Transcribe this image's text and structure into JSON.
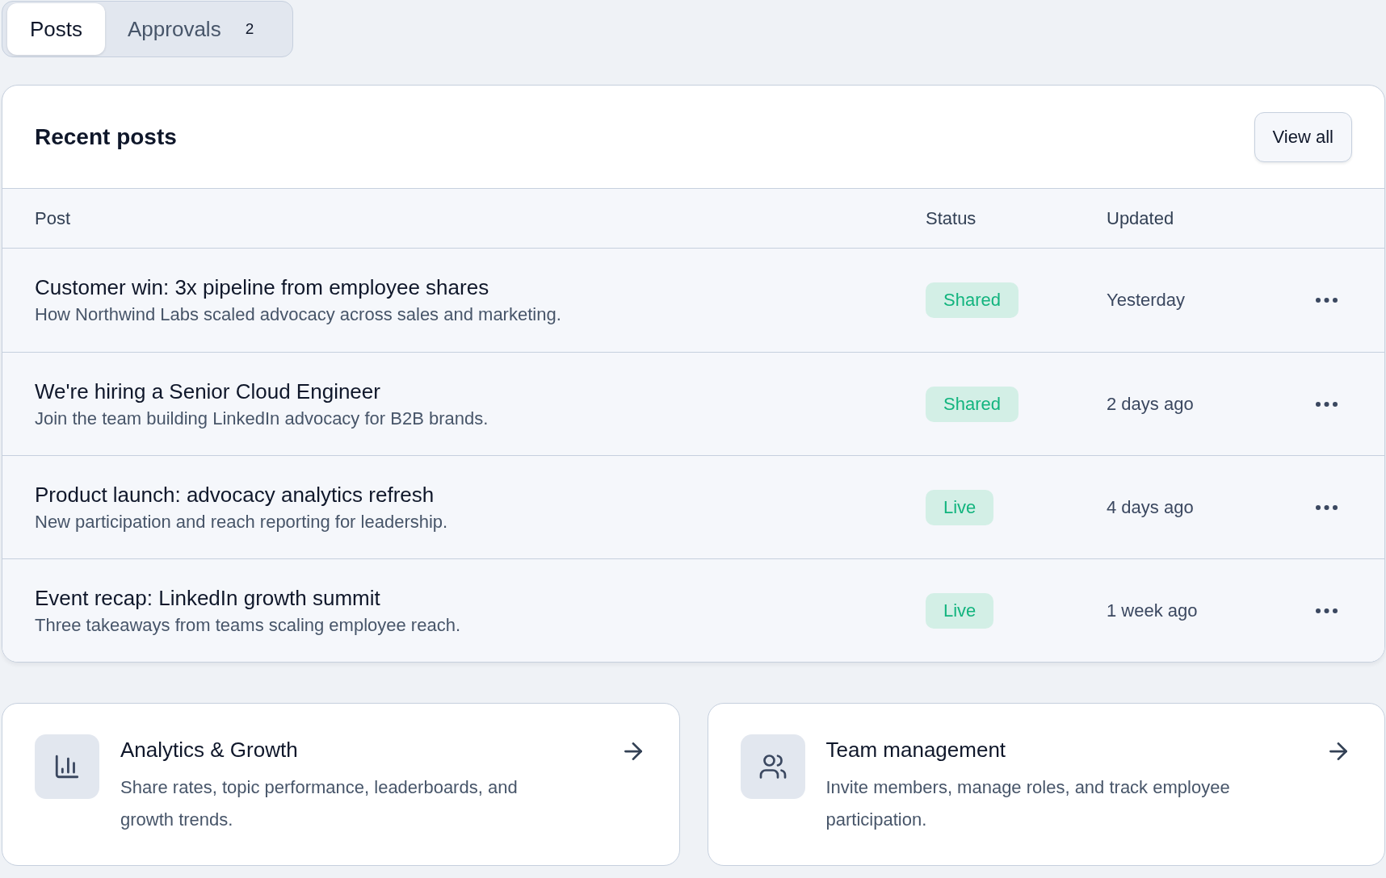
{
  "tabs": [
    {
      "label": "Posts",
      "selected": true
    },
    {
      "label": "Approvals",
      "count": "2",
      "selected": false
    }
  ],
  "recent_posts": {
    "title": "Recent posts",
    "view_all_button": "View all",
    "table": {
      "columns": [
        "Post",
        "Status",
        "Updated"
      ],
      "rows": [
        {
          "title": "Customer win: 3x pipeline from employee shares",
          "description": "How Northwind Labs scaled advocacy across sales and marketing.",
          "status": "Shared",
          "updated": "Yesterday"
        },
        {
          "title": "We're hiring a Senior Cloud Engineer",
          "description": "Join the team building LinkedIn advocacy for B2B brands.",
          "status": "Shared",
          "updated": "2 days ago"
        },
        {
          "title": "Product launch: advocacy analytics refresh",
          "description": "New participation and reach reporting for leadership.",
          "status": "Live",
          "updated": "4 days ago"
        },
        {
          "title": "Event recap: LinkedIn growth summit",
          "description": "Three takeaways from teams scaling employee reach.",
          "status": "Live",
          "updated": "1 week ago"
        }
      ]
    }
  },
  "feature_cards": [
    {
      "title": "Analytics & Growth",
      "description": "Share rates, topic performance, leaderboards, and growth trends."
    },
    {
      "title": "Team management",
      "description": "Invite members, manage roles, and track employee participation."
    }
  ]
}
